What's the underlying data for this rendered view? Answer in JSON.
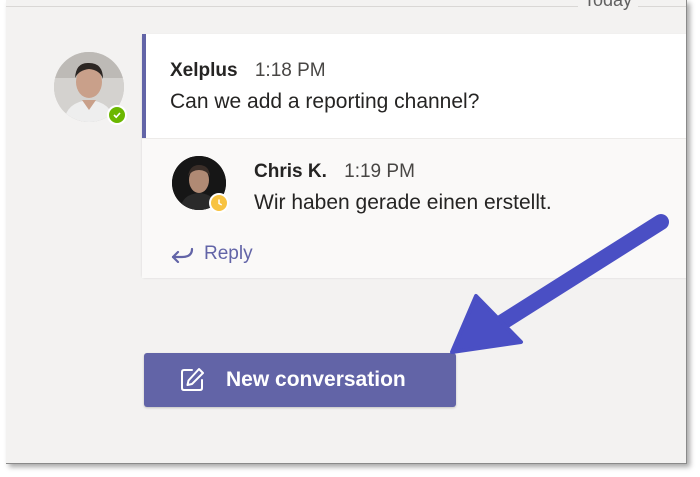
{
  "date_divider": {
    "label": "Today"
  },
  "thread": {
    "message": {
      "author": "Xelplus",
      "time": "1:18 PM",
      "text": "Can we add a reporting channel?",
      "presence": "available",
      "presence_color": "#6bb700"
    },
    "reply": {
      "author": "Chris K.",
      "time": "1:19 PM",
      "text": "Wir haben gerade einen erstellt.",
      "presence": "away",
      "presence_color": "#f8c341"
    },
    "reply_action": {
      "label": "Reply",
      "icon": "reply-arrow-icon"
    }
  },
  "new_conversation_button": {
    "label": "New conversation",
    "icon": "compose-icon"
  },
  "colors": {
    "accent": "#6264a7",
    "annotation_arrow": "#4a4fc4"
  }
}
